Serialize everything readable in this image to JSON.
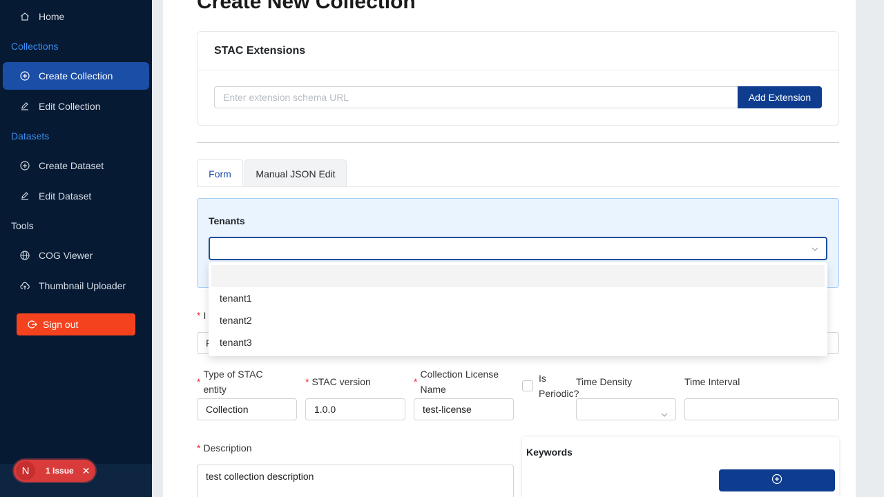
{
  "sidebar": {
    "home": "Home",
    "collections_header": "Collections",
    "create_collection": "Create Collection",
    "edit_collection": "Edit Collection",
    "datasets_header": "Datasets",
    "create_dataset": "Create Dataset",
    "edit_dataset": "Edit Dataset",
    "tools_header": "Tools",
    "cog_viewer": "COG Viewer",
    "thumbnail_uploader": "Thumbnail Uploader",
    "sign_out": "Sign out"
  },
  "issue_badge": {
    "initial": "N",
    "label": "1 Issue"
  },
  "page": {
    "title": "Create New Collection"
  },
  "extensions": {
    "title": "STAC Extensions",
    "placeholder": "Enter extension schema URL",
    "add_label": "Add Extension"
  },
  "tabs": [
    {
      "label": "Form",
      "active": true
    },
    {
      "label": "Manual JSON Edit",
      "active": false
    }
  ],
  "tenants": {
    "label": "Tenants",
    "value": "",
    "options": [
      "",
      "tenant1",
      "tenant2",
      "tenant3"
    ]
  },
  "form": {
    "id_label": "I",
    "id_value": "F",
    "type_label": "Type of STAC entity",
    "type_value": "Collection",
    "stac_version_label": "STAC version",
    "stac_version_value": "1.0.0",
    "license_label": "Collection License Name",
    "license_value": "test-license",
    "periodic_label": "Is Periodic?",
    "periodic_checked": false,
    "time_density_label": "Time Density",
    "time_density_value": "",
    "time_interval_label": "Time Interval",
    "time_interval_value": "",
    "description_label": "Description",
    "description_value": "test collection description",
    "keywords_title": "Keywords"
  },
  "colors": {
    "sidebar_bg": "#061a33",
    "accent": "#1b4ea6",
    "primary_button": "#0e3d8f",
    "sign_out": "#f5421e",
    "required": "#f5222d"
  }
}
